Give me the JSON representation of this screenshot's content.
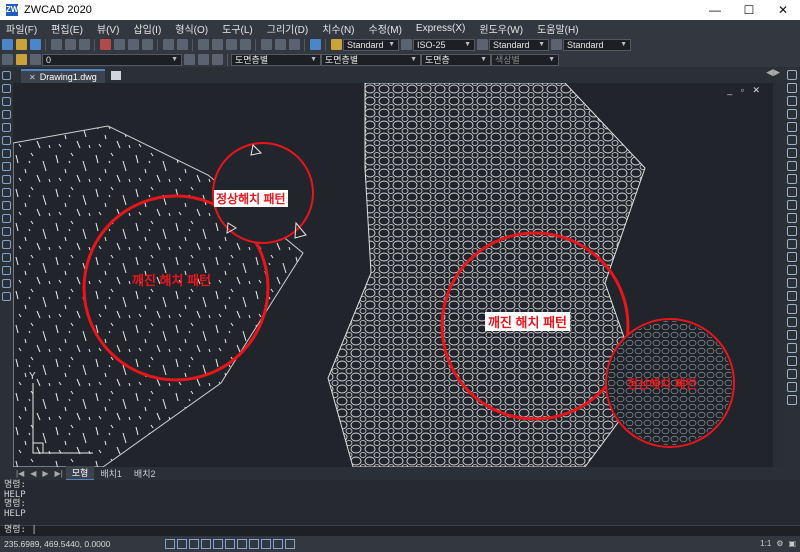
{
  "window": {
    "title": "ZWCAD 2020",
    "app_icon": "ZW",
    "controls": [
      "—",
      "☐",
      "✕"
    ]
  },
  "menu": [
    "파일(F)",
    "편집(E)",
    "뷰(V)",
    "삽입(I)",
    "형식(O)",
    "도구(L)",
    "그리기(D)",
    "치수(N)",
    "수정(M)",
    "Express(X)",
    "윈도우(W)",
    "도움말(H)"
  ],
  "toolbar1": {
    "text_style": "Standard",
    "dim_style": "ISO-25",
    "table_style": "Standard",
    "multileader_style": "Standard"
  },
  "toolbar2": {
    "layer": "0",
    "color": "도면층별",
    "linetype": "도면층별",
    "lineweight": "도면층",
    "plotstyle": "색상별"
  },
  "document_tab": {
    "name": "Drawing1.dwg",
    "close": "✕"
  },
  "canvas": {
    "label_left_big": "깨진 해치 패턴",
    "label_left_small": "정상해치 패턴",
    "label_right_big": "깨진 해치 패턴",
    "label_right_small": "정상해치 패턴",
    "viewport_controls": "_ ▫ ✕",
    "axis_y": "Y",
    "circle_color": "#e8151b"
  },
  "layout_tabs": {
    "nav": [
      "|◀",
      "◀",
      "▶",
      "▶|"
    ],
    "tabs": [
      "모형",
      "배치1",
      "배치2"
    ]
  },
  "command_history": [
    "명령:",
    "HELP",
    "명령:",
    "HELP"
  ],
  "command_prompt": "명령: |",
  "status": {
    "coords": "235.6989, 469.5440, 0.0000",
    "scale": "1:1"
  }
}
